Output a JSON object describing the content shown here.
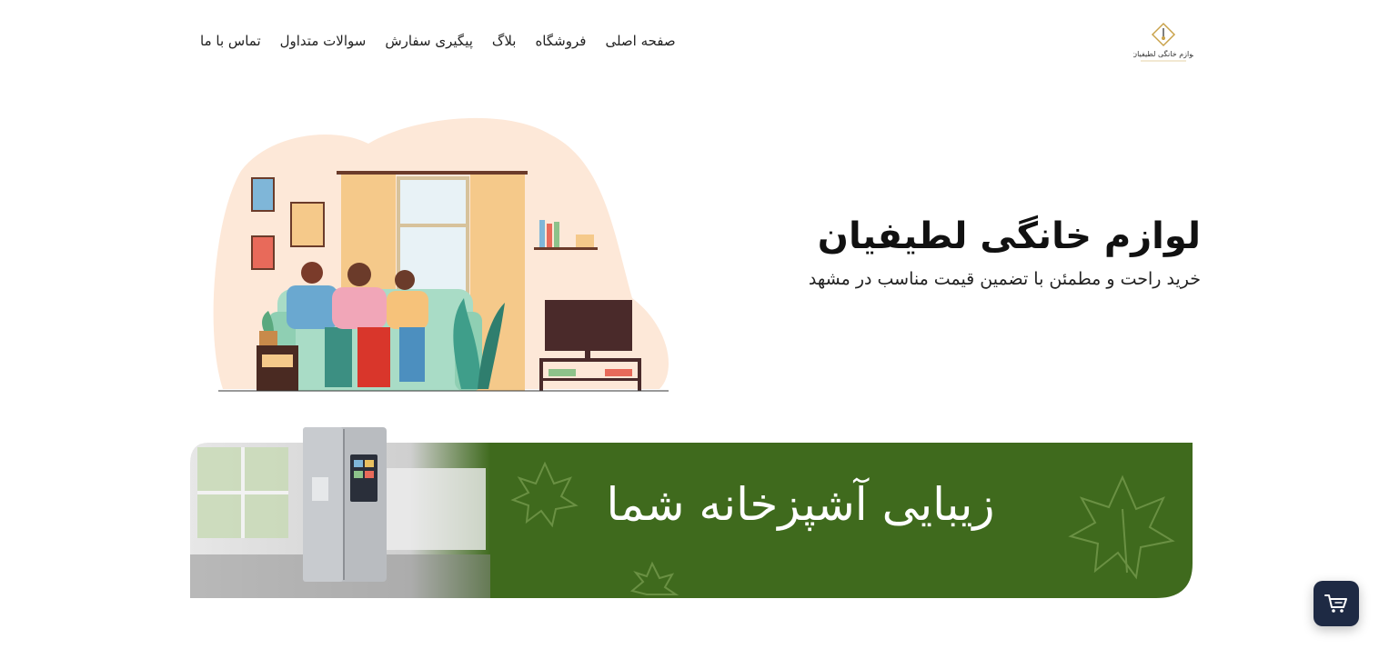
{
  "brand": {
    "logo_text": "لوازم خانگی لطیفیان",
    "accent": "#c9a24a"
  },
  "nav": {
    "items": [
      {
        "label": "صفحه اصلی"
      },
      {
        "label": "فروشگاه"
      },
      {
        "label": "بلاگ"
      },
      {
        "label": "پیگیری سفارش"
      },
      {
        "label": "سوالات متداول"
      },
      {
        "label": "تماس با ما"
      }
    ]
  },
  "hero": {
    "title": "لوازم خانگی لطیفیان",
    "subtitle": "خرید راحت و مطمئن با تضمین قیمت مناسب در مشهد"
  },
  "banner": {
    "text": "زیبایی آشپزخانه شما",
    "color": "#3f6a1d"
  },
  "cart": {
    "icon": "cart-icon",
    "color": "#1e2a44"
  }
}
